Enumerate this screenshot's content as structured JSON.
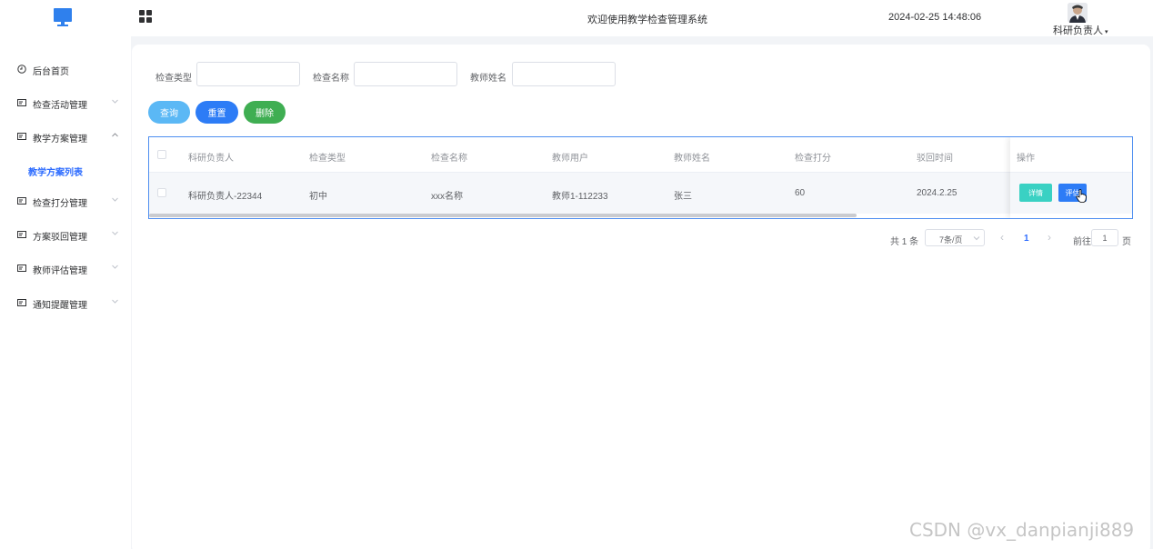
{
  "header": {
    "grid_icon": "grid-icon",
    "title": "欢迎使用教学检查管理系统",
    "datetime": "2024-02-25 14:48:06",
    "user_name": "科研负责人",
    "user_caret": "▾"
  },
  "sidebar": {
    "items": [
      {
        "label": "后台首页",
        "icon": "clock-icon"
      },
      {
        "label": "检查活动管理",
        "icon": "card-icon"
      },
      {
        "label": "教学方案管理",
        "icon": "card-icon"
      },
      {
        "label": "检查打分管理",
        "icon": "card-icon"
      },
      {
        "label": "方案驳回管理",
        "icon": "card-icon"
      },
      {
        "label": "教师评估管理",
        "icon": "card-icon"
      },
      {
        "label": "通知提醒管理",
        "icon": "card-icon"
      }
    ],
    "active_sub": "教学方案列表"
  },
  "search": {
    "type_label": "检查类型",
    "type_value": "",
    "name_label": "检查名称",
    "name_value": "",
    "teacher_label": "教师姓名",
    "teacher_value": ""
  },
  "buttons": {
    "query": "查询",
    "reset": "重置",
    "delete": "删除"
  },
  "table": {
    "columns": [
      "科研负责人",
      "检查类型",
      "检查名称",
      "教师用户",
      "教师姓名",
      "检查打分",
      "驳回时间",
      "操作"
    ],
    "rows": [
      {
        "leader": "科研负责人-22344",
        "type": "初中",
        "name": "xxx名称",
        "teacher_user": "教师1-112233",
        "teacher_name": "张三",
        "score": "60",
        "reject_time": "2024.2.25",
        "detail": "详情",
        "evaluate": "评估"
      }
    ]
  },
  "pagination": {
    "total": "共 1 条",
    "page_size": "7条/页",
    "prev": "‹",
    "current": "1",
    "next": "›",
    "goto_prefix": "前往",
    "goto_value": "1",
    "goto_suffix": "页"
  },
  "watermark": "CSDN @vx_danpianji889",
  "colors": {
    "accent": "#2d6cff",
    "query_btn": "#5bb8f5",
    "reset_btn": "#2d7cf6",
    "delete_btn": "#3fae52",
    "detail_btn": "#3ad1c3",
    "evaluate_btn": "#2d7cf6"
  }
}
